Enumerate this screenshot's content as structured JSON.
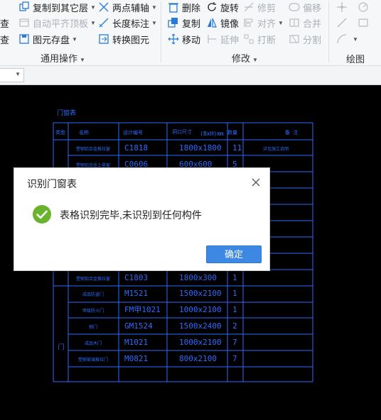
{
  "ribbon": {
    "col1": {
      "row1": "复制到其它层",
      "row2": "自动平齐顶板",
      "row3": "图元存盘",
      "left1": "查",
      "left2": "查"
    },
    "col2": {
      "row1": "两点辅轴",
      "row2": "长度标注",
      "row3": "转换图元"
    },
    "group1_label": "通用操作",
    "col3": {
      "row1": "删除",
      "row2": "复制",
      "row3": "移动"
    },
    "col4": {
      "row1": "旋转",
      "row2": "镜像",
      "row3": "延伸"
    },
    "col5": {
      "row1": "修剪",
      "row2": "对齐",
      "row3": "打断"
    },
    "col6": {
      "row1": "偏移",
      "row2": "合并",
      "row3": "分割"
    },
    "group2_label": "修改",
    "group3_label": "绘图"
  },
  "cad": {
    "table_title": "门窗表",
    "headers": {
      "type": "类型",
      "name": "名称",
      "code": "设计编号",
      "size": "洞口尺寸",
      "size_unit": "(BxH)mm",
      "qty": "数量",
      "note": "备 注"
    },
    "type_door": "门",
    "rows": [
      {
        "name": "塑钢铝合金推拉窗",
        "code": "C1818",
        "size": "1800x1800",
        "qty": "11",
        "note": "详见施工说明"
      },
      {
        "name": "塑钢铝合金上悬窗",
        "code": "C0606",
        "size": "600x600",
        "qty": "5",
        "note": ""
      },
      {
        "name": "塑钢铝合金推拉窗",
        "code": "C1803",
        "size": "1800x300",
        "qty": "1",
        "note": ""
      },
      {
        "name": "成品防盗门",
        "code": "M1521",
        "size": "1500x2100",
        "qty": "1",
        "note": ""
      },
      {
        "name": "甲级防火门",
        "code": "FM甲1021",
        "size": "1000x2100",
        "qty": "1",
        "note": ""
      },
      {
        "name": "钢门",
        "code": "GM1524",
        "size": "1500x2400",
        "qty": "2",
        "note": ""
      },
      {
        "name": "成品木门",
        "code": "M1021",
        "size": "1000x2100",
        "qty": "7",
        "note": ""
      },
      {
        "name": "塑钢玻璃推拉门",
        "code": "M0821",
        "size": "800x2100",
        "qty": "7",
        "note": ""
      }
    ]
  },
  "dialog": {
    "title": "识别门窗表",
    "message": "表格识别完毕,未识别到任何构件",
    "ok_label": "确定"
  },
  "colors": {
    "cad_line": "#2f6bff",
    "cad_text": "#2f6bff",
    "ok_button": "#3c88e2",
    "success": "#6ab42d"
  }
}
